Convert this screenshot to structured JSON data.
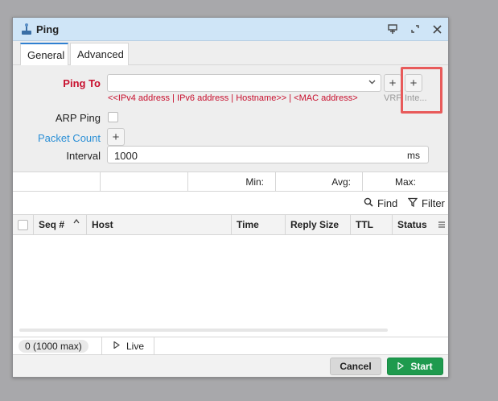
{
  "window": {
    "title": "Ping"
  },
  "tabs": [
    {
      "label": "General",
      "active": true
    },
    {
      "label": "Advanced",
      "active": false
    }
  ],
  "form": {
    "ping_to_label": "Ping To",
    "ping_to_value": "",
    "ping_to_hint": "<<IPv4 address | IPv6 address | Hostname>> | <MAC address>",
    "vrf_label": "VRF",
    "interface_label": "Inte...",
    "arp_ping_label": "ARP Ping",
    "arp_ping_checked": false,
    "packet_count_label": "Packet Count",
    "interval_label": "Interval",
    "interval_value": "1000",
    "interval_unit": "ms"
  },
  "stats": {
    "min_label": "Min:",
    "avg_label": "Avg:",
    "max_label": "Max:"
  },
  "toolbar": {
    "find_label": "Find",
    "filter_label": "Filter"
  },
  "table": {
    "columns": [
      "Seq #",
      "Host",
      "Time",
      "Reply Size",
      "TTL",
      "Status"
    ],
    "rows": []
  },
  "statusbar": {
    "count": "0 (1000 max)",
    "live_label": "Live"
  },
  "footer": {
    "cancel_label": "Cancel",
    "start_label": "Start"
  },
  "colors": {
    "accent": "#2f80d1",
    "required": "#c8102e",
    "link": "#2a8fd6",
    "start": "#1e9a4e",
    "titlebar": "#cfe5f7"
  }
}
